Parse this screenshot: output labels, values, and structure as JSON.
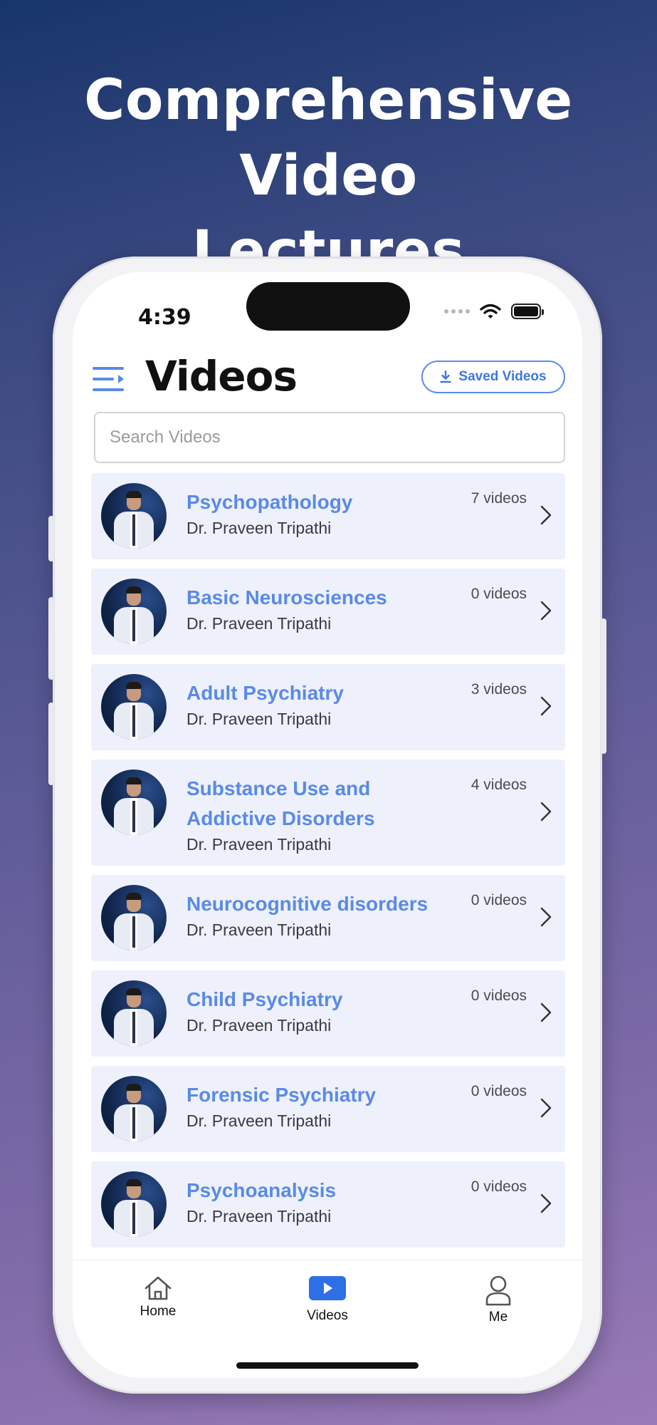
{
  "headline": {
    "line1": "Comprehensive Video",
    "line2": "Lectures"
  },
  "status_bar": {
    "time": "4:39",
    "icons": [
      "signal-dots-icon",
      "wifi-icon",
      "battery-icon"
    ]
  },
  "header": {
    "title": "Videos",
    "saved_button": "Saved Videos"
  },
  "search": {
    "placeholder": "Search Videos",
    "value": ""
  },
  "courses": [
    {
      "name": "Psychopathology",
      "author": "Dr. Praveen Tripathi",
      "count": "7 videos"
    },
    {
      "name": "Basic Neurosciences",
      "author": "Dr. Praveen Tripathi",
      "count": "0 videos"
    },
    {
      "name": "Adult Psychiatry",
      "author": "Dr. Praveen Tripathi",
      "count": "3 videos"
    },
    {
      "name": "Substance Use and Addictive Disorders",
      "author": "Dr. Praveen Tripathi",
      "count": "4 videos"
    },
    {
      "name": "Neurocognitive disorders",
      "author": "Dr. Praveen Tripathi",
      "count": "0 videos"
    },
    {
      "name": "Child Psychiatry",
      "author": "Dr. Praveen Tripathi",
      "count": "0 videos"
    },
    {
      "name": "Forensic Psychiatry",
      "author": "Dr. Praveen Tripathi",
      "count": "0 videos"
    },
    {
      "name": "Psychoanalysis",
      "author": "Dr. Praveen Tripathi",
      "count": "0 videos"
    }
  ],
  "tabs": [
    {
      "label": "Home",
      "icon": "home-icon"
    },
    {
      "label": "Videos",
      "icon": "video-play-icon",
      "active": true
    },
    {
      "label": "Me",
      "icon": "person-icon"
    }
  ],
  "colors": {
    "accent": "#5a8ae6",
    "active_tab": "#2f6fe6",
    "card_bg": "#eef1fb"
  }
}
